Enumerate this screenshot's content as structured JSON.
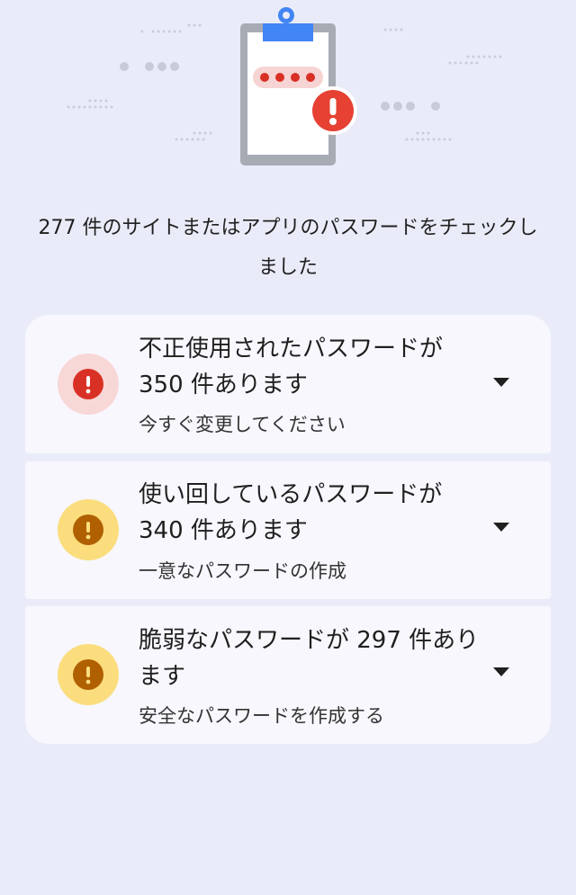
{
  "summary": {
    "text": "277 件のサイトまたはアプリのパスワードをチェックしました"
  },
  "items": [
    {
      "title": "不正使用されたパスワードが 350 件あります",
      "subtitle": "今すぐ変更してください",
      "severity": "red"
    },
    {
      "title": "使い回しているパスワードが 340 件あります",
      "subtitle": "一意なパスワードの作成",
      "severity": "yellow"
    },
    {
      "title": "脆弱なパスワードが 297 件あります",
      "subtitle": "安全なパスワードを作成する",
      "severity": "yellow"
    }
  ],
  "icons": {
    "hero": "clipboard-password-alert-icon",
    "alert": "exclamation-icon",
    "expand": "chevron-down-icon"
  },
  "colors": {
    "background": "#e9ecf8",
    "card": "#f7f7fd",
    "danger": "#d93025",
    "danger_soft": "#f8d7d7",
    "warning": "#b06000",
    "warning_soft": "#fbdd7e",
    "accent": "#4285f4"
  }
}
